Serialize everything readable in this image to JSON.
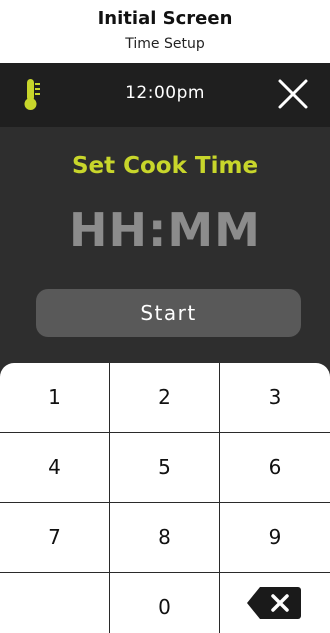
{
  "caption": {
    "title": "Initial Screen",
    "subtitle": "Time Setup"
  },
  "topbar": {
    "clock": "12:00pm",
    "left_icon": "thermometer-icon",
    "right_icon": "close-icon"
  },
  "main": {
    "heading": "Set Cook Time",
    "time_display": "HH:MM",
    "start_label": "Start"
  },
  "keypad": {
    "keys": [
      "1",
      "2",
      "3",
      "4",
      "5",
      "6",
      "7",
      "8",
      "9",
      "",
      "0"
    ],
    "backspace_icon": "backspace-icon"
  },
  "colors": {
    "accent": "#c8d62b",
    "screen_bg": "#2e2e2e",
    "topbar_bg": "#1f1f1f",
    "button_bg": "#595959",
    "display_text": "#8c8c8c"
  }
}
